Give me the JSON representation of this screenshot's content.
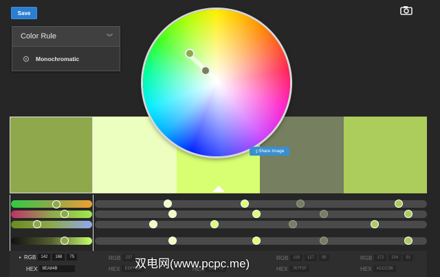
{
  "toolbar": {
    "save_label": "Save",
    "camera_icon": "camera-icon"
  },
  "color_rule": {
    "title": "Color Rule",
    "option": "Monochromatic"
  },
  "swatches": [
    "#8ea84b",
    "#edffbe",
    "#d8ff72",
    "#767f5f",
    "#accc5b"
  ],
  "share_label": "Share Image",
  "active_swatch": {
    "rgb_label": "RGB",
    "hex_label": "HEX",
    "rgb": [
      "142",
      "168",
      "75"
    ],
    "hex": "8EA84B"
  },
  "other_swatches": [
    {
      "rgb": [
        "237",
        "",
        ""
      ],
      "hex": "EDFFBE"
    },
    {
      "rgb": [
        "",
        "",
        ""
      ],
      "hex": "D8FF72"
    },
    {
      "rgb": [
        "118",
        "127",
        "95"
      ],
      "hex": "767F5F"
    },
    {
      "rgb": [
        "172",
        "204",
        "91"
      ],
      "hex": "ACCC5B"
    }
  ],
  "watermark": "双电网(www.pcpc.me)"
}
